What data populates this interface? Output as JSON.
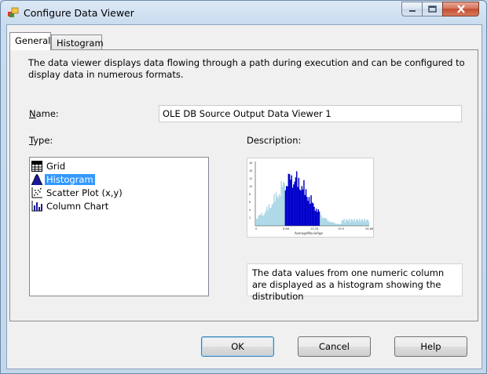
{
  "window": {
    "title": "Configure Data Viewer"
  },
  "tabs": [
    {
      "label": "General"
    },
    {
      "label": "Histogram"
    }
  ],
  "general": {
    "description": "The data viewer displays data flowing through a path during execution and can be configured to display data in numerous formats.",
    "name_label_prefix": "N",
    "name_label_rest": "ame:",
    "name_value": "OLE DB Source Output Data Viewer 1",
    "type_label_prefix": "T",
    "type_label_rest": "ype:",
    "description_label": "Description:",
    "types": [
      {
        "label": "Grid",
        "icon": "grid-icon"
      },
      {
        "label": "Histogram",
        "icon": "histogram-icon",
        "selected": true
      },
      {
        "label": "Scatter Plot (x,y)",
        "icon": "scatter-plot-icon"
      },
      {
        "label": "Column Chart",
        "icon": "column-chart-icon"
      }
    ],
    "preview": {
      "xlabel": "AverageMovieAge",
      "xticks": [
        "0",
        "6.66",
        "13.33",
        "19.9",
        "26.66"
      ],
      "yticks": [
        "18",
        "16",
        "12",
        "10",
        "8",
        "6",
        "4",
        "2"
      ]
    },
    "type_description": "The data values from one numeric column are displayed as a histogram showing the distribution"
  },
  "buttons": {
    "ok": "OK",
    "cancel": "Cancel",
    "help": "Help"
  },
  "colors": {
    "selection": "#3399ff",
    "histogram_light": "#add8e6",
    "histogram_dark": "#0000cc"
  }
}
